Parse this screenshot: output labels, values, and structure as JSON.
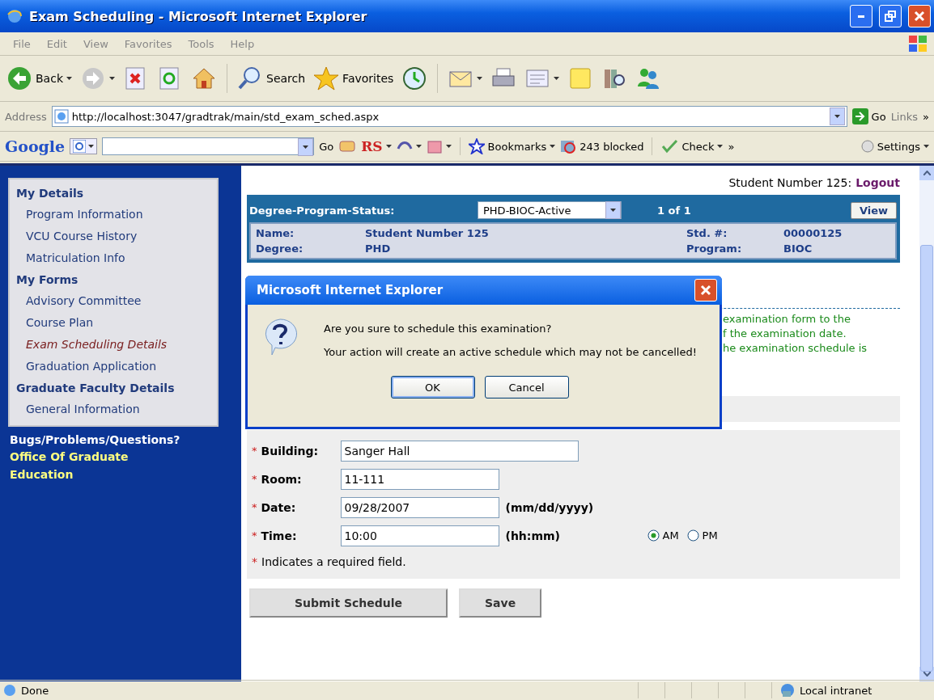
{
  "window": {
    "title": "Exam Scheduling - Microsoft Internet Explorer"
  },
  "menu": [
    "File",
    "Edit",
    "View",
    "Favorites",
    "Tools",
    "Help"
  ],
  "toolbar": [
    {
      "kind": "back",
      "label": "Back"
    },
    {
      "kind": "forward"
    },
    {
      "kind": "stop"
    },
    {
      "kind": "refresh"
    },
    {
      "kind": "home"
    },
    {
      "kind": "search",
      "label": "Search"
    },
    {
      "kind": "favorites",
      "label": "Favorites"
    },
    {
      "kind": "history"
    },
    {
      "kind": "mail"
    },
    {
      "kind": "print"
    },
    {
      "kind": "edit"
    },
    {
      "kind": "note"
    },
    {
      "kind": "research"
    },
    {
      "kind": "messenger"
    }
  ],
  "address": {
    "label": "Address",
    "url": "http://localhost:3047/gradtrak/main/std_exam_sched.aspx",
    "go": "Go",
    "links": "Links",
    "more": "»"
  },
  "google_bar": {
    "logo": "Google",
    "go": "Go",
    "rs": "RS",
    "bookmarks": "Bookmarks",
    "blocked": "243 blocked",
    "check": "Check",
    "more": "»",
    "settings": "Settings"
  },
  "sidebar": {
    "sections": [
      {
        "heading": "My Details",
        "items": [
          {
            "label": "Program Information",
            "selected": false
          },
          {
            "label": "VCU Course History",
            "selected": false
          },
          {
            "label": "Matriculation Info",
            "selected": false
          }
        ]
      },
      {
        "heading": "My Forms",
        "items": [
          {
            "label": "Advisory Committee",
            "selected": false
          },
          {
            "label": "Course Plan",
            "selected": false
          },
          {
            "label": "Exam Scheduling Details",
            "selected": true
          },
          {
            "label": "Graduation Application",
            "selected": false
          }
        ]
      },
      {
        "heading": "Graduate Faculty Details",
        "items": [
          {
            "label": "General Information",
            "selected": false
          }
        ]
      }
    ],
    "help_title": "Bugs/Problems/Questions?",
    "help_link": "Office Of Graduate Education"
  },
  "user": {
    "name": "Student Number 125:",
    "logout": "Logout"
  },
  "status_row": {
    "label": "Degree-Program-Status:",
    "value": "PHD-BIOC-Active",
    "count": "1 of 1",
    "view": "View"
  },
  "details": [
    {
      "label": "Name:",
      "value": "Student Number 125",
      "label_2": "Std. #:",
      "value_2": "00000125"
    },
    {
      "label": "Degree:",
      "value": "PHD",
      "label_2": "Program:",
      "value_2": "BIOC"
    }
  ],
  "notice_fragments": [
    "examination form to the",
    "f the examination date.",
    "he examination schedule is"
  ],
  "dialog": {
    "title": "Microsoft Internet Explorer",
    "lines": [
      "Are you sure to schedule this examination?",
      "Your action will create an active schedule which may not be cancelled!"
    ],
    "buttons": [
      {
        "label": "OK",
        "default": true
      },
      {
        "label": "Cancel",
        "default": false
      }
    ]
  },
  "form": {
    "fields": [
      {
        "mark": "*",
        "label": "Building:",
        "value": "Sanger Hall"
      },
      {
        "mark": "*",
        "label": "Room:",
        "value": "11-111"
      },
      {
        "mark": "*",
        "label": "Date:",
        "value": "09/28/2007",
        "hint": "(mm/dd/yyyy)"
      },
      {
        "mark": "*",
        "label": "Time:",
        "value": "10:00",
        "hint": "(hh:mm)",
        "options": [
          {
            "label": "AM",
            "selected": true
          },
          {
            "label": "PM",
            "selected": false
          }
        ]
      }
    ],
    "note": {
      "mark": "*",
      "text": "Indicates a required field."
    }
  },
  "buttons": [
    "Submit Schedule",
    "Save"
  ],
  "status_bar": {
    "text": "Done",
    "zone": "Local intranet"
  }
}
